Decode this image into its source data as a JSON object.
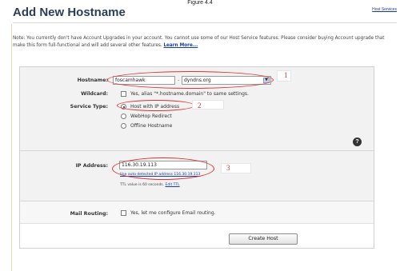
{
  "figure_caption": "Figure 4.4",
  "header": {
    "title": "Add New Hostname",
    "top_link": "Host Services"
  },
  "note": {
    "text": "Note: You currently don't have Account Upgrades in your account. You cannot use some of our Host Service features. Please consider buying Account upgrade that make this form full-functional and will add several other features. ",
    "link": "Learn More..."
  },
  "form": {
    "hostname": {
      "label": "Hostname:",
      "value": "foscamhawk",
      "separator": ".",
      "domain": "dyndns.org"
    },
    "wildcard": {
      "label": "Wildcard:",
      "text": "Yes, alias \"*.hostname.domain\" to same settings."
    },
    "service_type": {
      "label": "Service Type:",
      "options": [
        "Host with IP address",
        "WebHop Redirect",
        "Offline Hostname"
      ],
      "selected": "Host with IP address"
    },
    "ip_address": {
      "label": "IP Address:",
      "value": "116.30.19.113",
      "auto_link": "Use auto detected IP address 116.30.19.113",
      "ttl_text": "TTL value is 60 seconds. ",
      "ttl_link": "Edit TTL"
    },
    "mail_routing": {
      "label": "Mail Routing:",
      "text": "Yes, let me configure Email routing."
    },
    "submit_label": "Create Host"
  },
  "annotations": {
    "num1": "1",
    "num2": "2",
    "num3": "3"
  },
  "icons": {
    "help": "help-icon",
    "dropdown": "chevron-down-icon"
  },
  "colors": {
    "title": "#2a3e58",
    "link": "#1a3c9c",
    "annotation": "#e03030"
  }
}
